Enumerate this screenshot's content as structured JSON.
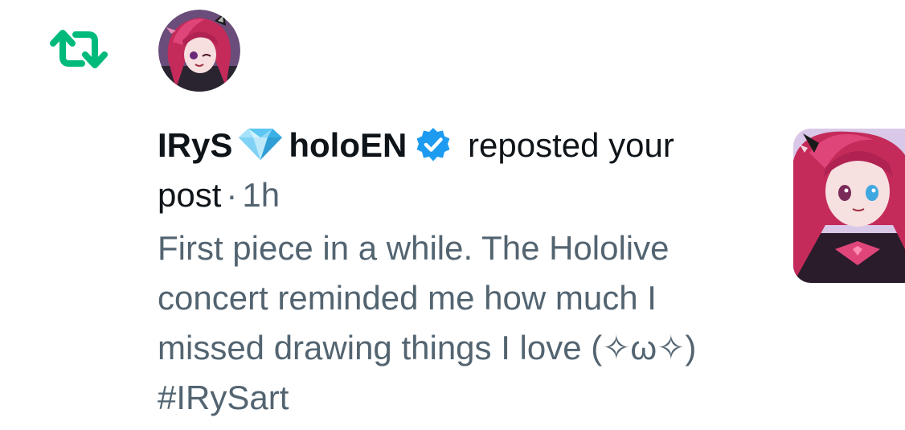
{
  "notification": {
    "display_name": "IRyS",
    "handle_suffix": "holoEN",
    "action_text": "reposted your",
    "object_text": "post",
    "separator": "·",
    "timestamp": "1h",
    "post_text": "First piece in a while. The Hololive concert reminded me how much I missed drawing things I love (✧ω✧) #IRySart"
  },
  "icons": {
    "repost": "repost-icon",
    "gem": "gem-icon",
    "verified": "verified-badge-icon",
    "avatar": "avatar",
    "thumbnail": "post-thumbnail"
  },
  "colors": {
    "repost_green": "#00BA7C",
    "verified_blue": "#1D9BF0",
    "primary_text": "#0F1419",
    "secondary_text": "#536471",
    "avatar_hair": "#C42B5A",
    "background": "#FFFFFF"
  }
}
